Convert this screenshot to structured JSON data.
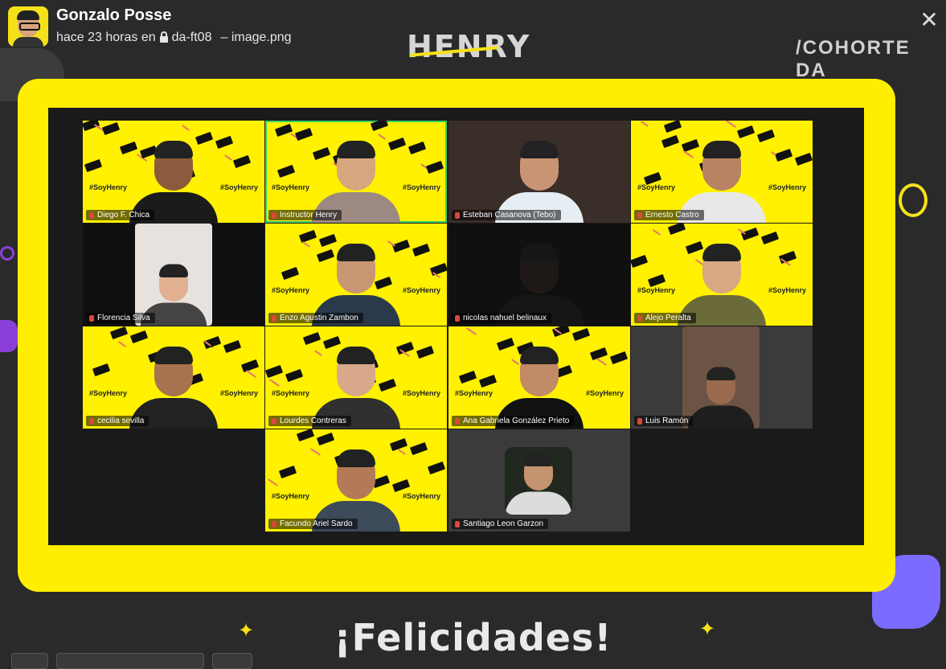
{
  "header": {
    "username": "Gonzalo Posse",
    "time": "hace 23 horas en",
    "channel": "da-ft08",
    "file": "– image.png",
    "close_symbol": "✕"
  },
  "banner": {
    "brand": "HENRY",
    "cohort": "/COHORTE DA",
    "footer": "¡Felicidades!"
  },
  "tiles": [
    {
      "name": "Diego F. Chica",
      "bg": "yellow"
    },
    {
      "name": "Instructor Henry",
      "bg": "yellow",
      "active": true
    },
    {
      "name": "Esteban Casanova (Tebo)",
      "bg": "room"
    },
    {
      "name": "Ernesto Castro",
      "bg": "yellow"
    },
    {
      "name": "Florencia Silva",
      "bg": "dark"
    },
    {
      "name": "Enzo Agustin Zambon",
      "bg": "yellow"
    },
    {
      "name": "nicolas nahuel belinaux",
      "bg": "dark"
    },
    {
      "name": "Alejo Peralta",
      "bg": "yellow"
    },
    {
      "name": "cecilia sevilla",
      "bg": "yellow"
    },
    {
      "name": "Lourdes Contreras",
      "bg": "yellow"
    },
    {
      "name": "Ana Gabriela González Prieto",
      "bg": "yellow"
    },
    {
      "name": "Luis Ramón",
      "bg": "gray"
    },
    {
      "name": "Facundo Ariel Sardo",
      "bg": "yellow"
    },
    {
      "name": "Santiago Leon Garzon",
      "bg": "gray"
    }
  ],
  "tags": {
    "soyhenry": "#SoyHenry"
  },
  "colors": {
    "brand_yellow": "#ffee00",
    "background": "#2a2a2a",
    "active_border": "#36d36b"
  }
}
